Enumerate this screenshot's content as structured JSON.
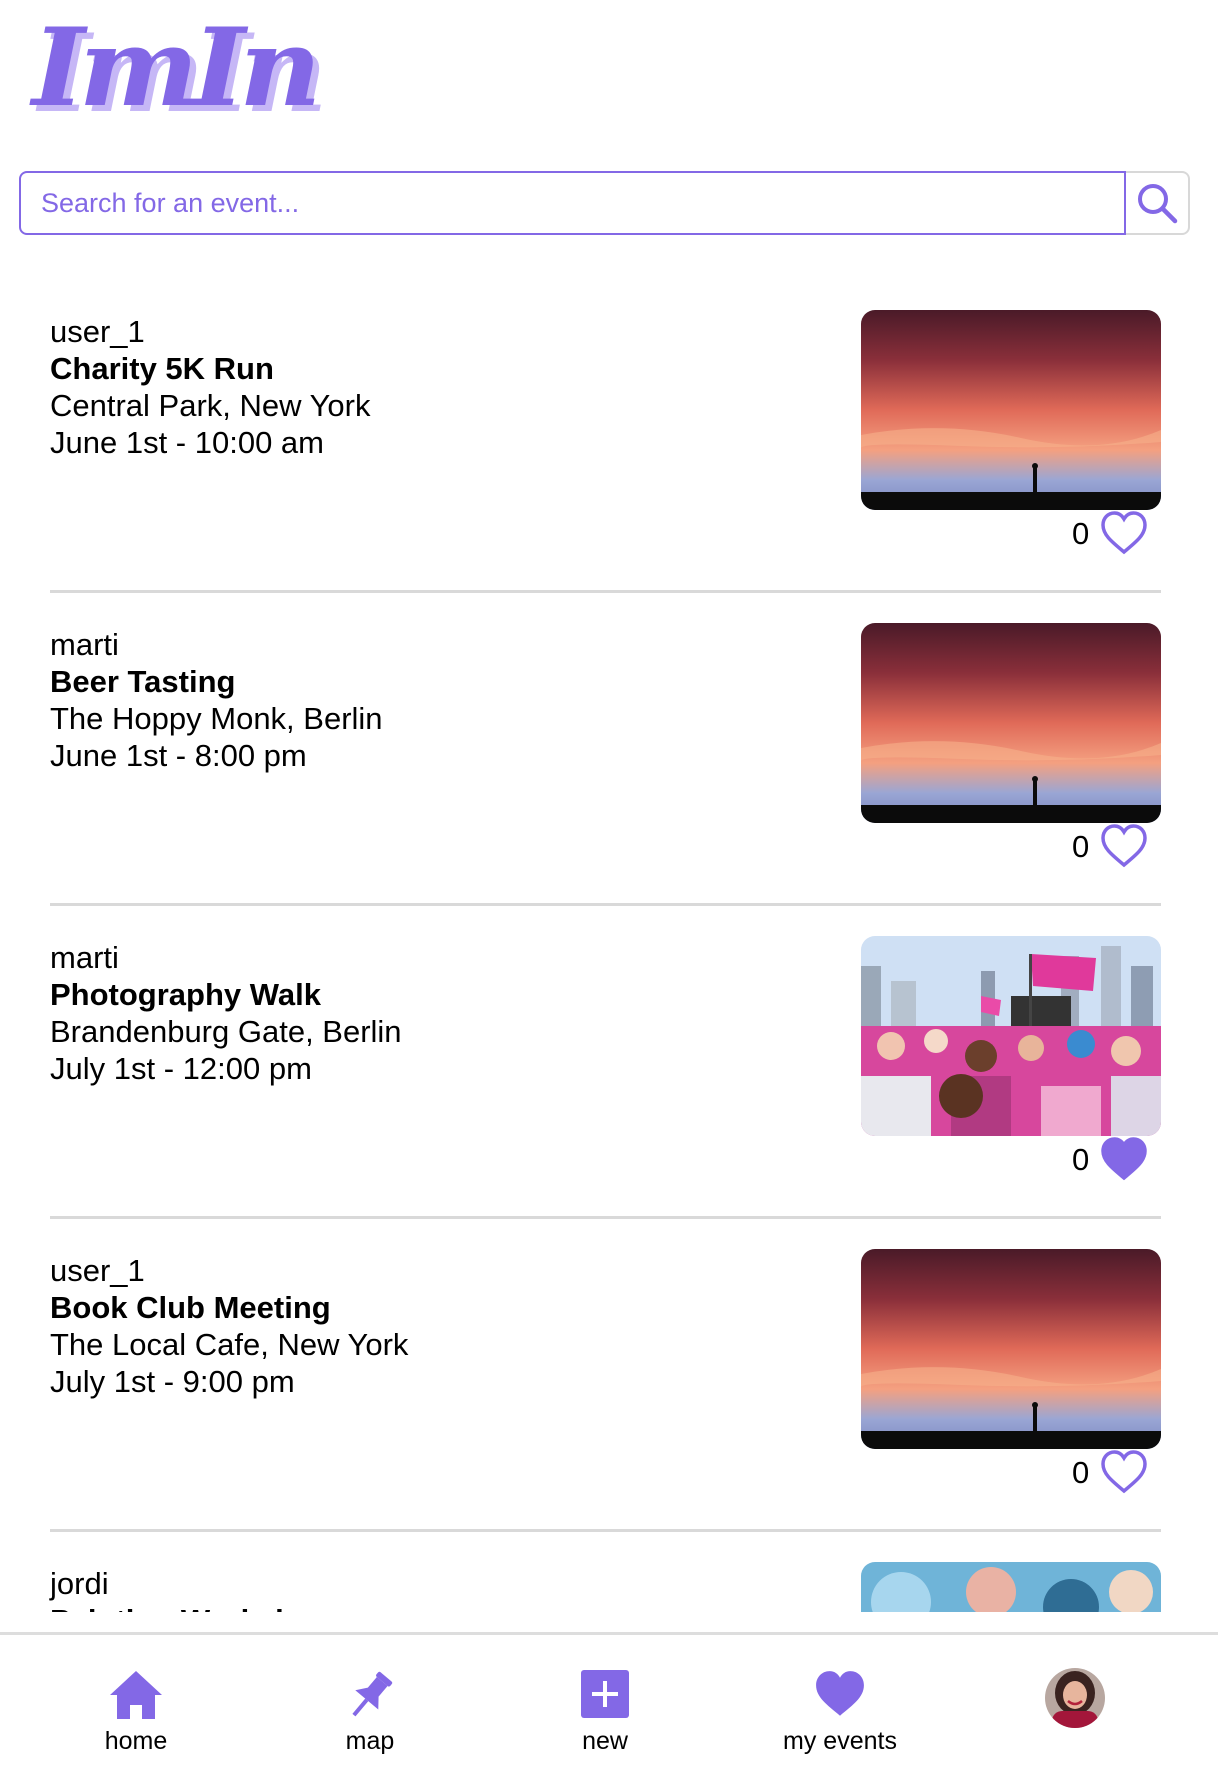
{
  "app": {
    "logo_text": "ImIn"
  },
  "colors": {
    "accent": "#8368e6",
    "accent_light": "#c6b7f6",
    "divider": "#d9d9d9"
  },
  "search": {
    "placeholder": "Search for an event...",
    "icon": "search-icon"
  },
  "events": [
    {
      "user": "user_1",
      "title": "Charity 5K Run",
      "location": "Central Park, New York",
      "datetime": "June 1st - 10:00 am",
      "likes": "0",
      "liked": false,
      "image": "sunset"
    },
    {
      "user": "marti",
      "title": "Beer Tasting",
      "location": "The Hoppy Monk, Berlin",
      "datetime": "June 1st - 8:00 pm",
      "likes": "0",
      "liked": false,
      "image": "sunset"
    },
    {
      "user": "marti",
      "title": "Photography Walk",
      "location": "Brandenburg Gate, Berlin",
      "datetime": "July 1st - 12:00 pm",
      "likes": "0",
      "liked": true,
      "image": "crowd"
    },
    {
      "user": "user_1",
      "title": "Book Club Meeting",
      "location": "The Local Cafe, New York",
      "datetime": "July 1st - 9:00 pm",
      "likes": "0",
      "liked": false,
      "image": "sunset"
    },
    {
      "user": "jordi",
      "title": "Painting Workshop",
      "location": "",
      "datetime": "",
      "likes": "",
      "liked": false,
      "image": "blue-crowd"
    }
  ],
  "nav": [
    {
      "label": "home",
      "icon": "home-icon"
    },
    {
      "label": "map",
      "icon": "pin-icon"
    },
    {
      "label": "new",
      "icon": "plus-square-icon"
    },
    {
      "label": "my events",
      "icon": "heart-icon"
    },
    {
      "label": "",
      "icon": "avatar"
    }
  ]
}
